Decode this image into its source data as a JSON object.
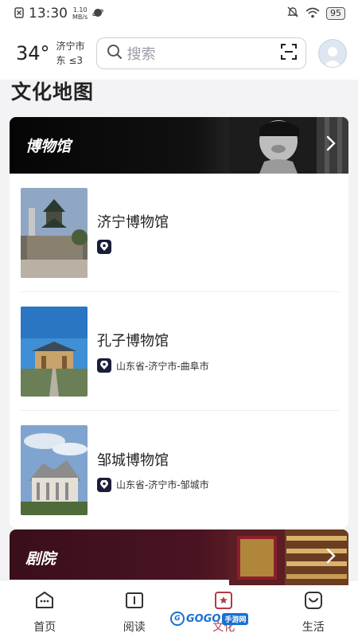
{
  "status_bar": {
    "time": "13:30",
    "net_speed_value": "1.10",
    "net_speed_unit": "MB/s",
    "battery": "95"
  },
  "header": {
    "temperature": "34°",
    "city": "济宁市",
    "wind": "东 ≤3",
    "search_placeholder": "搜索"
  },
  "page_title": "文化地图",
  "museum_section": {
    "title": "博物馆",
    "items": [
      {
        "name": "济宁博物馆",
        "location": ""
      },
      {
        "name": "孔子博物馆",
        "location": "山东省-济宁市-曲阜市"
      },
      {
        "name": "邹城博物馆",
        "location": "山东省-济宁市-邹城市"
      }
    ]
  },
  "theater_section": {
    "title": "剧院"
  },
  "bottom_nav": {
    "items": [
      {
        "label": "首页",
        "icon": "home-icon"
      },
      {
        "label": "阅读",
        "icon": "book-icon"
      },
      {
        "label": "文化",
        "icon": "culture-icon"
      },
      {
        "label": "生活",
        "icon": "life-icon"
      }
    ],
    "active_index": 2
  },
  "watermark": {
    "text": "GOGO",
    "badge": "手游网"
  },
  "colors": {
    "accent": "#b23a48",
    "pin_bg": "#1b1e3a",
    "museum_banner": "#050505",
    "theater_banner": "#4a1322"
  }
}
